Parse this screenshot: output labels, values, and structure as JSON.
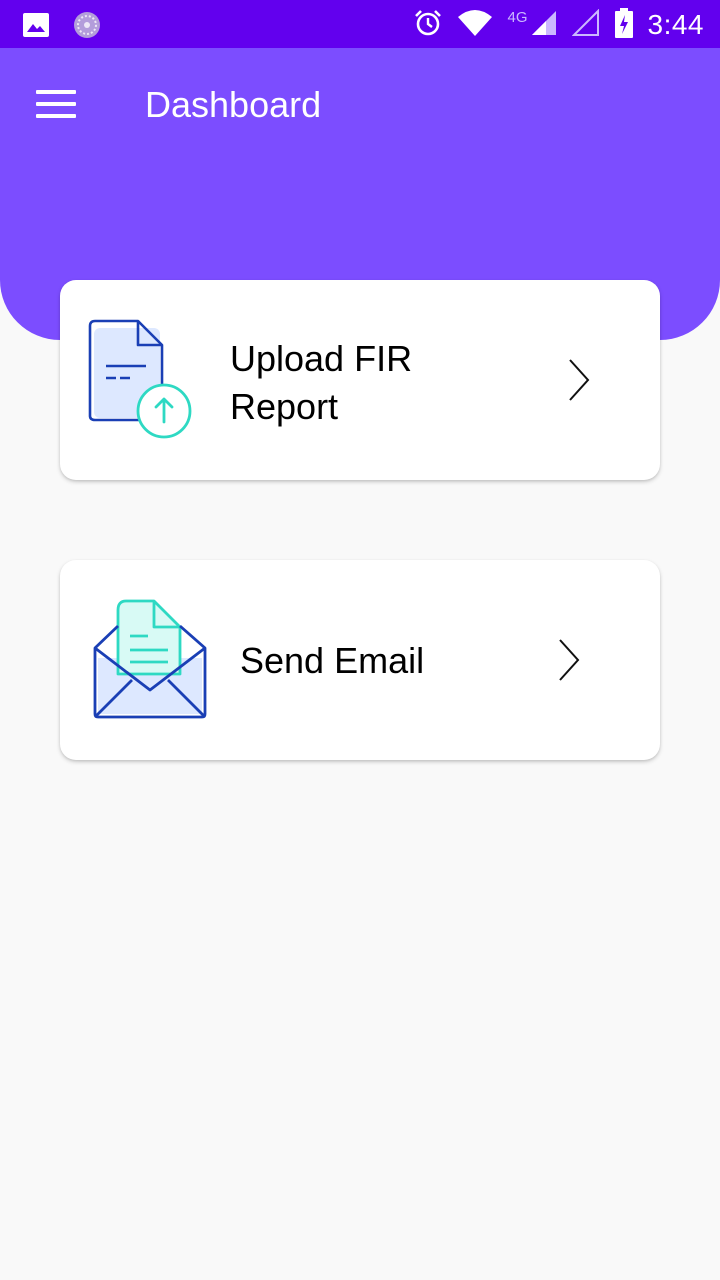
{
  "status_bar": {
    "time": "3:44",
    "network_type": "4G",
    "icons": [
      "image-icon",
      "app-notification-icon",
      "alarm-icon",
      "wifi-icon",
      "signal-icon",
      "signal-empty-icon",
      "battery-charging-icon"
    ]
  },
  "header": {
    "title": "Dashboard",
    "menu_icon": "hamburger-menu-icon"
  },
  "cards": [
    {
      "label_line1": "Upload FIR",
      "label_line2": "Report",
      "icon": "document-upload-icon",
      "chevron_icon": "chevron-right-icon"
    },
    {
      "label": "Send Email",
      "icon": "open-envelope-document-icon",
      "chevron_icon": "chevron-right-icon"
    }
  ],
  "colors": {
    "status_bar": "#6200ee",
    "header": "#7c4dff",
    "background": "#f9f9f9",
    "icon_blue": "#1a3fb5",
    "icon_teal": "#2ed9c3"
  }
}
